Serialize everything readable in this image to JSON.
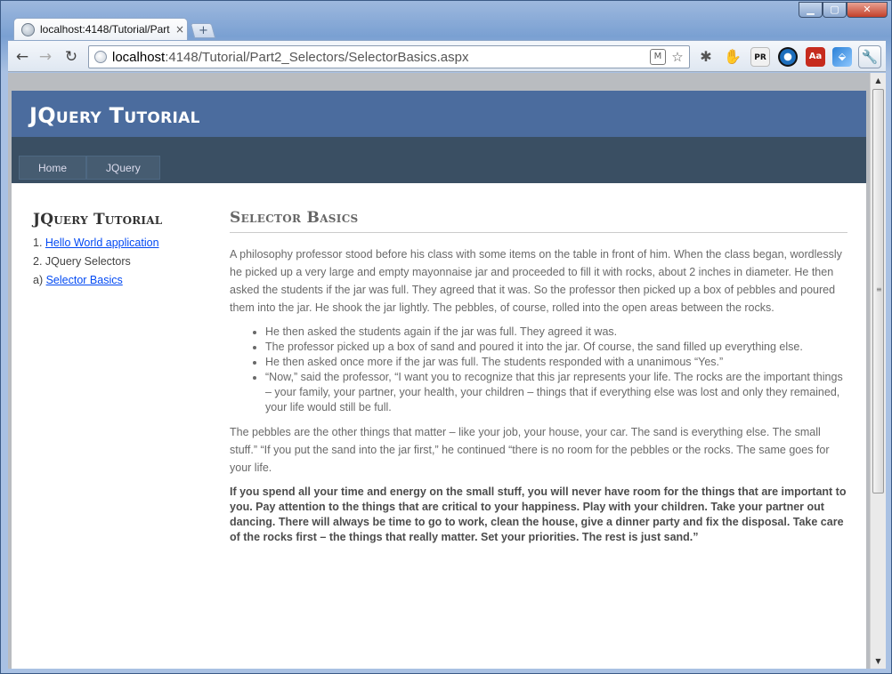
{
  "browser": {
    "tab_title": "localhost:4148/Tutorial/Part",
    "tab_close": "×",
    "new_tab": "+",
    "controls": {
      "minimize": "▁",
      "maximize": "▢",
      "close": "✕"
    },
    "nav": {
      "back": "←",
      "forward": "→",
      "reload": "↻"
    },
    "url_host": "localhost",
    "url_rest": ":4148/Tutorial/Part2_Selectors/SelectorBasics.aspx",
    "icons": [
      "page-icon",
      "m-icon",
      "star-icon",
      "bug-icon",
      "hand-icon",
      "pr-icon",
      "eye-icon",
      "acrobat-icon",
      "puzzle-icon",
      "wrench-icon"
    ],
    "ext_labels": {
      "pr": "PR",
      "acrobat": "Aa"
    }
  },
  "site": {
    "title": "JQuery Tutorial",
    "menu": [
      "Home",
      "JQuery"
    ]
  },
  "sidebar": {
    "title": "JQuery Tutorial",
    "items": [
      {
        "prefix": "1. ",
        "label": "Hello World application",
        "link": true
      },
      {
        "prefix": "2. ",
        "label": "JQuery Selectors",
        "link": false
      },
      {
        "prefix": "a) ",
        "label": "Selector Basics",
        "link": true
      }
    ]
  },
  "main": {
    "heading": "Selector Basics",
    "para1": "A philosophy professor stood before his class with some items on the table in front of him. When the class began, wordlessly he picked up a very large and empty mayonnaise jar and proceeded to fill it with rocks, about 2 inches in diameter. He then asked the students if the jar was full. They agreed that it was. So the professor then picked up a box of pebbles and poured them into the jar. He shook the jar lightly. The pebbles, of course, rolled into the open areas between the rocks.",
    "bullets": [
      "He then asked the students again if the jar was full. They agreed it was.",
      "The professor picked up a box of sand and poured it into the jar. Of course, the sand filled up everything else.",
      "He then asked once more if the jar was full. The students responded with a unanimous “Yes.”",
      "“Now,” said the professor, “I want you to recognize that this jar represents your life. The rocks are the important things – your family, your partner, your health, your children – things that if everything else was lost and only they remained, your life would still be full."
    ],
    "para2": "The pebbles are the other things that matter – like your job, your house, your car. The sand is everything else. The small stuff.” “If you put the sand into the jar first,” he continued “there is no room for the pebbles or the rocks. The same goes for your life.",
    "para3": "If you spend all your time and energy on the small stuff, you will never have room for the things that are important to you. Pay attention to the things that are critical to your happiness. Play with your children. Take your partner out dancing. There will always be time to go to work, clean the house, give a dinner party and fix the disposal. Take care of the rocks first – the things that really matter. Set your priorities. The rest is just sand.”"
  }
}
